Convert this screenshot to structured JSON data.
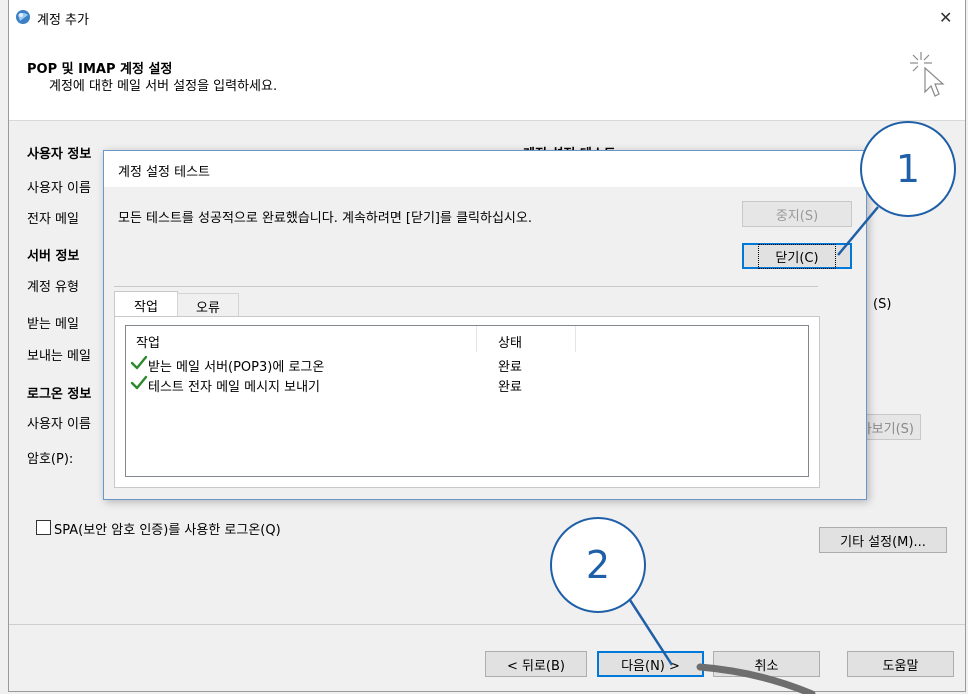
{
  "window": {
    "title": "계정 추가",
    "close_glyph": "✕"
  },
  "header": {
    "title": "POP 및 IMAP 계정 설정",
    "subtitle": "계정에 대한 메일 서버 설정을 입력하세요."
  },
  "form": {
    "user_info_heading": "사용자 정보",
    "user_name_label": "사용자 이름",
    "email_label": "전자 메일",
    "server_info_heading": "서버 정보",
    "account_type_label": "계정 유형",
    "incoming_label": "받는 메일",
    "outgoing_label": "보내는 메일",
    "logon_heading": "로그온 정보",
    "logon_user_label": "사용자 이름",
    "password_label": "암호(P):",
    "test_heading": "계정 설정 테스트",
    "right_s_label": "(S)",
    "preview_button": "아보기(S)",
    "spa_checkbox_label": "SPA(보안 암호 인증)를 사용한 로그온(Q)",
    "more_settings_button": "기타 설정(M)..."
  },
  "footer": {
    "back_button": "< 뒤로(B)",
    "next_button": "다음(N) >",
    "cancel_button": "취소",
    "help_button": "도움말"
  },
  "dialog": {
    "title": "계정 설정 테스트",
    "message": "모든 테스트를 성공적으로 완료했습니다. 계속하려면 [닫기]를 클릭하십시오.",
    "stop_button": "중지(S)",
    "close_button": "닫기(C)",
    "tabs": [
      "작업",
      "오류"
    ],
    "columns": [
      "작업",
      "상태"
    ],
    "rows": [
      {
        "task": "받는 메일 서버(POP3)에 로그온",
        "status": "완료"
      },
      {
        "task": "테스트 전자 메일 메시지 보내기",
        "status": "완료"
      }
    ]
  },
  "callouts": [
    "1",
    "2"
  ],
  "colors": {
    "accent": "#0078d7",
    "callout": "#1f5fa8",
    "check_green": "#2c8a2c",
    "arrow_gray": "#6e6e6e"
  },
  "icons": [
    "globe-mail-icon",
    "close-icon",
    "wizard-cursor-icon",
    "checkmark-icon"
  ]
}
